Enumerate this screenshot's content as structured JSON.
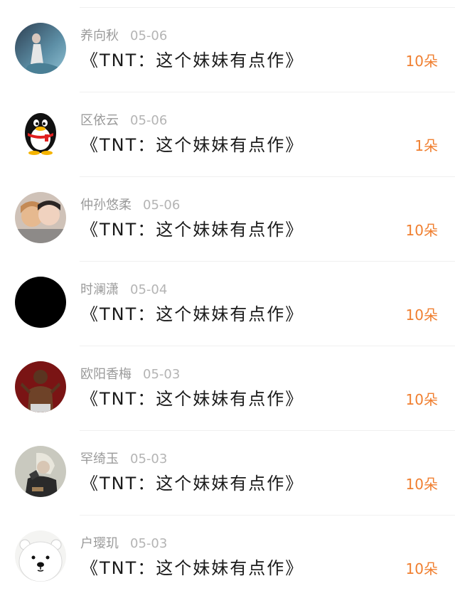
{
  "colors": {
    "count_accent": "#f07f30",
    "name_gray": "#9a9a9a",
    "title_text": "#1a1a1a"
  },
  "list": {
    "items": [
      {
        "name": "养向秋",
        "date": "05-06",
        "title": "《TNT：这个妹妹有点作》",
        "count": "10朵",
        "avatar_icon": "avatar-photo-icon"
      },
      {
        "name": "区依云",
        "date": "05-06",
        "title": "《TNT：这个妹妹有点作》",
        "count": "1朵",
        "avatar_icon": "qq-penguin-icon"
      },
      {
        "name": "仲孙悠柔",
        "date": "05-06",
        "title": "《TNT：这个妹妹有点作》",
        "count": "10朵",
        "avatar_icon": "avatar-photo-icon"
      },
      {
        "name": "时澜潇",
        "date": "05-04",
        "title": "《TNT：这个妹妹有点作》",
        "count": "10朵",
        "avatar_icon": "avatar-black-icon"
      },
      {
        "name": "欧阳香梅",
        "date": "05-03",
        "title": "《TNT：这个妹妹有点作》",
        "count": "10朵",
        "avatar_icon": "avatar-photo-icon"
      },
      {
        "name": "罕绮玉",
        "date": "05-03",
        "title": "《TNT：这个妹妹有点作》",
        "count": "10朵",
        "avatar_icon": "avatar-photo-icon"
      },
      {
        "name": "户璎玑",
        "date": "05-03",
        "title": "《TNT：这个妹妹有点作》",
        "count": "10朵",
        "avatar_icon": "bear-avatar-icon"
      }
    ]
  }
}
